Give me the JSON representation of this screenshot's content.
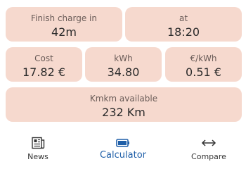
{
  "cards": {
    "finish_charge": {
      "label": "Finish charge in",
      "value": "42m"
    },
    "at": {
      "label": "at",
      "value": "18:20"
    },
    "cost": {
      "label": "Cost",
      "value": "17.82 €"
    },
    "kwh": {
      "label": "kWh",
      "value": "34.80"
    },
    "eur_per_kwh": {
      "label": "€/kWh",
      "value": "0.51 €"
    },
    "km_available": {
      "label": "Kmkm available",
      "value": "232 Km"
    }
  },
  "nav": {
    "items": [
      {
        "label": "News",
        "icon": "newspaper-icon"
      },
      {
        "label": "Calculator",
        "icon": "battery-icon",
        "active": true
      },
      {
        "label": "Compare",
        "icon": "compare-arrows-icon"
      }
    ]
  },
  "colors": {
    "card_bg": "#f6d9ce",
    "active_nav": "#1f5fa8"
  }
}
